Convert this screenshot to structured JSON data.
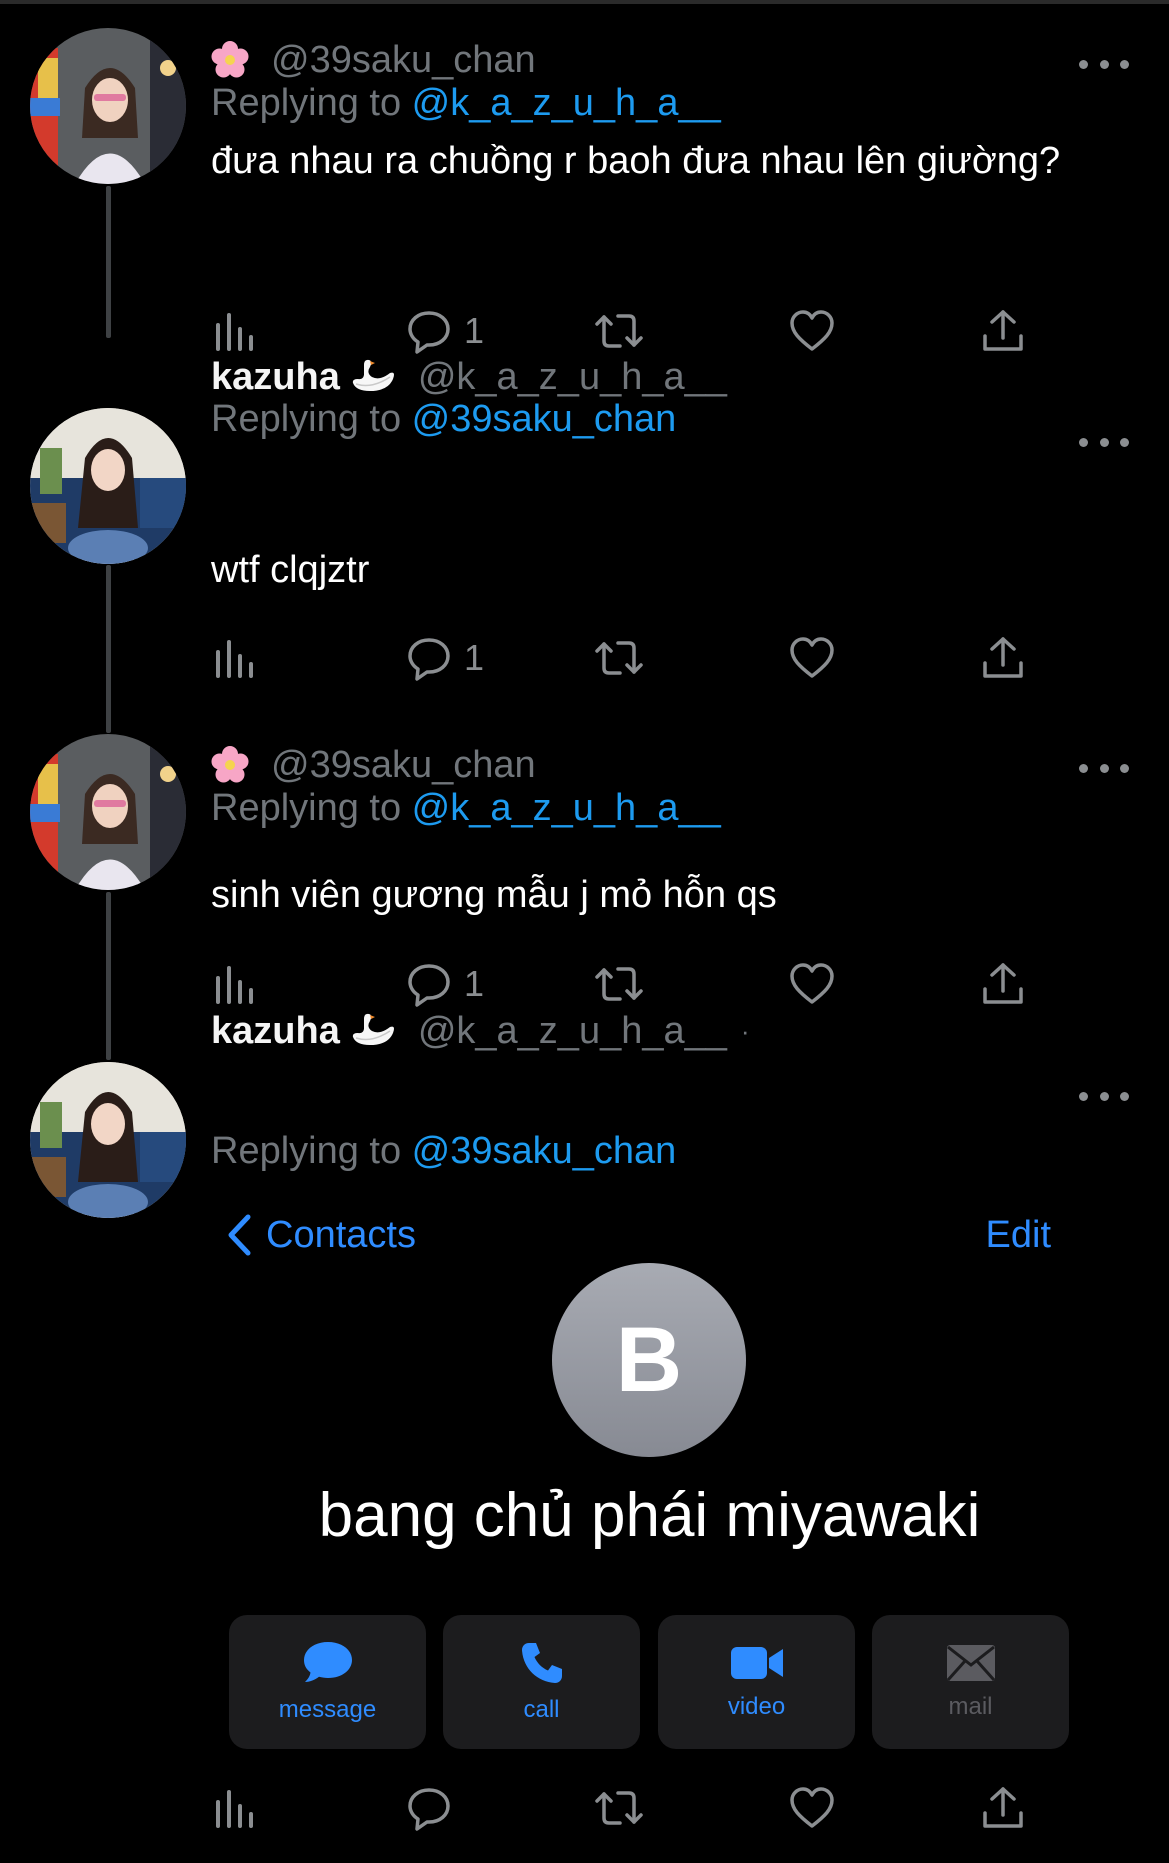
{
  "tweets": [
    {
      "emoji": "🌸",
      "name": "",
      "handle": "@39saku_chan",
      "replying_prefix": "Replying to ",
      "replying_to": "@k_a_z_u_h_a__",
      "text": "đưa nhau ra chuồng r baoh đưa nhau lên giường?",
      "reply_count": "1"
    },
    {
      "emoji": "🦢",
      "name": "kazuha",
      "handle": "@k_a_z_u_h_a__",
      "replying_prefix": "Replying to ",
      "replying_to": "@39saku_chan",
      "text": "wtf clqjztr",
      "reply_count": "1"
    },
    {
      "emoji": "🌸",
      "name": "",
      "handle": "@39saku_chan",
      "replying_prefix": "Replying to ",
      "replying_to": "@k_a_z_u_h_a__",
      "text": "sinh viên gương mẫu j mỏ hỗn qs",
      "reply_count": "1"
    },
    {
      "emoji": "🦢",
      "name": "kazuha",
      "handle": "@k_a_z_u_h_a__",
      "handle_suffix": "·",
      "replying_prefix": "Replying to ",
      "replying_to": "@39saku_chan"
    }
  ],
  "contact_card": {
    "back_label": "Contacts",
    "edit_label": "Edit",
    "initial": "B",
    "name": "bang chủ phái miyawaki",
    "buttons": {
      "message": "message",
      "call": "call",
      "video": "video",
      "mail": "mail"
    }
  },
  "icons": {
    "views": "bar-chart-icon",
    "reply": "speech-bubble-icon",
    "retweet": "retweet-icon",
    "like": "heart-icon",
    "share": "share-upload-icon",
    "more": "more-dots-icon"
  },
  "colors": {
    "background": "#000000",
    "link_blue": "#1d9bf0",
    "ios_blue": "#2f8cff",
    "muted": "#71767b"
  }
}
